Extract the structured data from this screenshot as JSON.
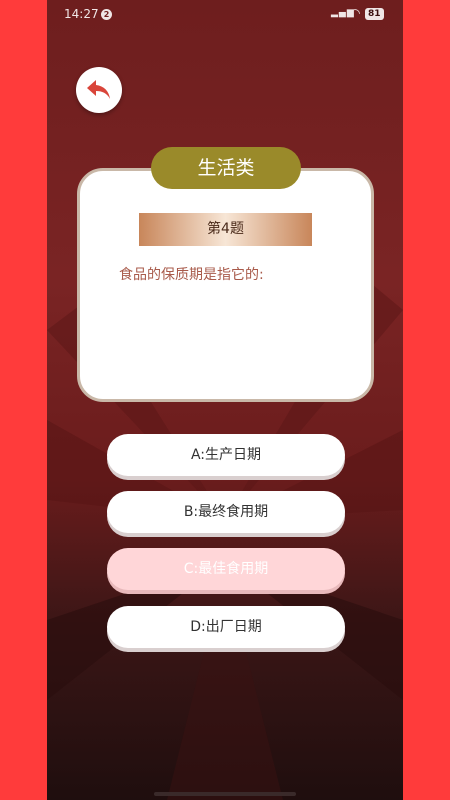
{
  "status_bar": {
    "time": "14:27",
    "notification_count": "2",
    "network": "4G",
    "battery": "81"
  },
  "header": {
    "back_icon": "back-arrow-icon"
  },
  "quiz": {
    "category": "生活类",
    "question_number": "第4题",
    "question": "食品的保质期是指它的:",
    "options": [
      {
        "label": "A:生产日期"
      },
      {
        "label": "B:最终食用期"
      },
      {
        "label": "C:最佳食用期",
        "state": "selected-faded"
      },
      {
        "label": "D:出厂日期"
      }
    ]
  },
  "colors": {
    "outer_bg": "#ff3b3b",
    "phone_bg": "#6e1e1e",
    "category_pill": "#9a8a2a",
    "question_text": "#a85a4a",
    "faded_option": "#ffd6d8",
    "back_arrow": "#d9453a"
  }
}
